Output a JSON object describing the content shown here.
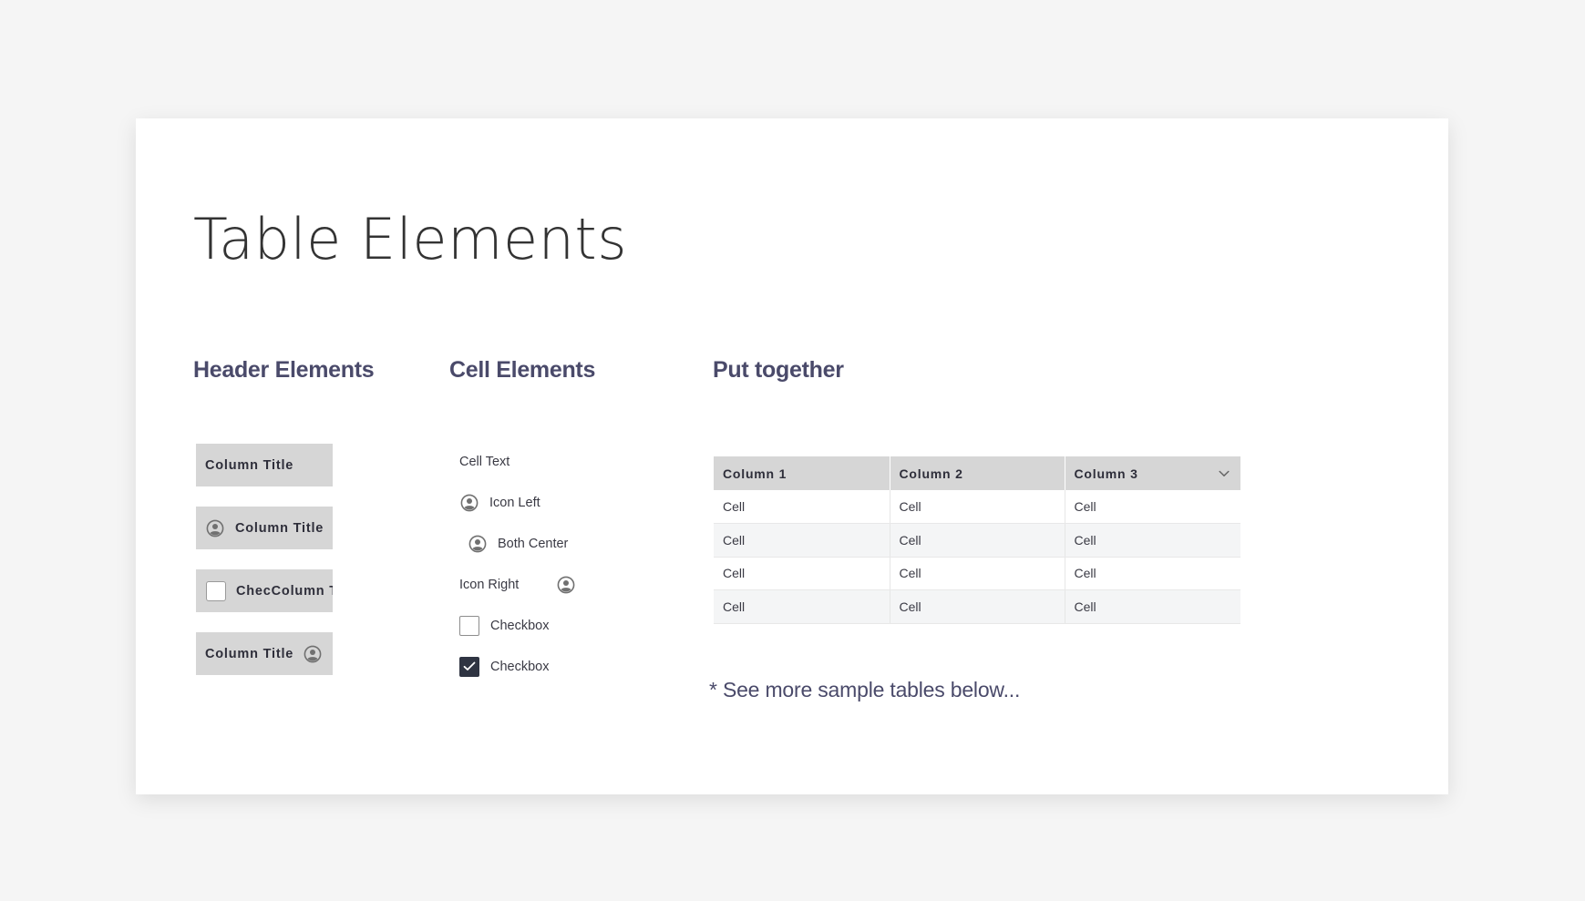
{
  "page": {
    "title": "Table Elements"
  },
  "sections": {
    "header": "Header Elements",
    "cell": "Cell Elements",
    "together": "Put together"
  },
  "header_elements": [
    {
      "label": "Column Title",
      "variant": "plain"
    },
    {
      "label": "Column Title",
      "variant": "icon-left",
      "icon": "user-circle-icon"
    },
    {
      "label": "ChecColumn Title",
      "variant": "checkbox"
    },
    {
      "label": "Column Title",
      "variant": "icon-right",
      "icon": "user-circle-icon"
    }
  ],
  "cell_elements": {
    "cell_text": "Cell Text",
    "icon_left": "Icon Left",
    "both_center": "Both Center",
    "icon_right": "Icon Right",
    "checkbox_unchecked": "Checkbox",
    "checkbox_checked": "Checkbox"
  },
  "table": {
    "columns": [
      "Column 1",
      "Column 2",
      "Column 3"
    ],
    "sort_icon": "chevron-down-icon",
    "rows": [
      [
        "Cell",
        "Cell",
        "Cell"
      ],
      [
        "Cell",
        "Cell",
        "Cell"
      ],
      [
        "Cell",
        "Cell",
        "Cell"
      ],
      [
        "Cell",
        "Cell",
        "Cell"
      ]
    ]
  },
  "footnote": "* See more sample tables below...",
  "colors": {
    "background": "#f5f5f5",
    "card": "#ffffff",
    "header_fill": "#d6d6d6",
    "heading_text": "#4a4a6a",
    "checkbox_checked": "#2f3442",
    "row_alt": "#f4f5f6"
  }
}
